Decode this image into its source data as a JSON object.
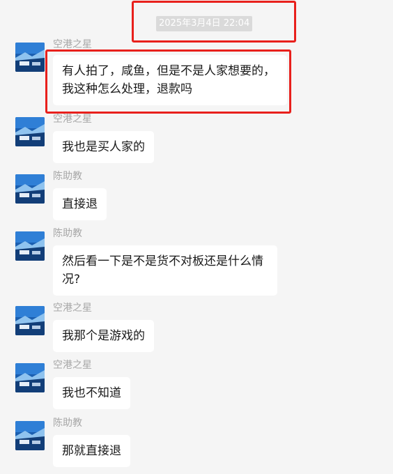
{
  "timestamp": "2025年3月4日 22:04",
  "messages": [
    {
      "sender": "空港之星",
      "text": "有人拍了，咸鱼，但是不是人家想要的，我这种怎么处理，退款吗"
    },
    {
      "sender": "空港之星",
      "text": "我也是买人家的"
    },
    {
      "sender": "陈助教",
      "text": "直接退"
    },
    {
      "sender": "陈助教",
      "text": "然后看一下是不是货不对板还是什么情况?"
    },
    {
      "sender": "空港之星",
      "text": "我那个是游戏的"
    },
    {
      "sender": "空港之星",
      "text": "我也不知道"
    },
    {
      "sender": "陈助教",
      "text": "那就直接退"
    }
  ],
  "colors": {
    "background": "#f5f5f5",
    "bubble": "#ffffff",
    "highlight": "#e8201c",
    "sender_text": "#a7a7a7"
  }
}
